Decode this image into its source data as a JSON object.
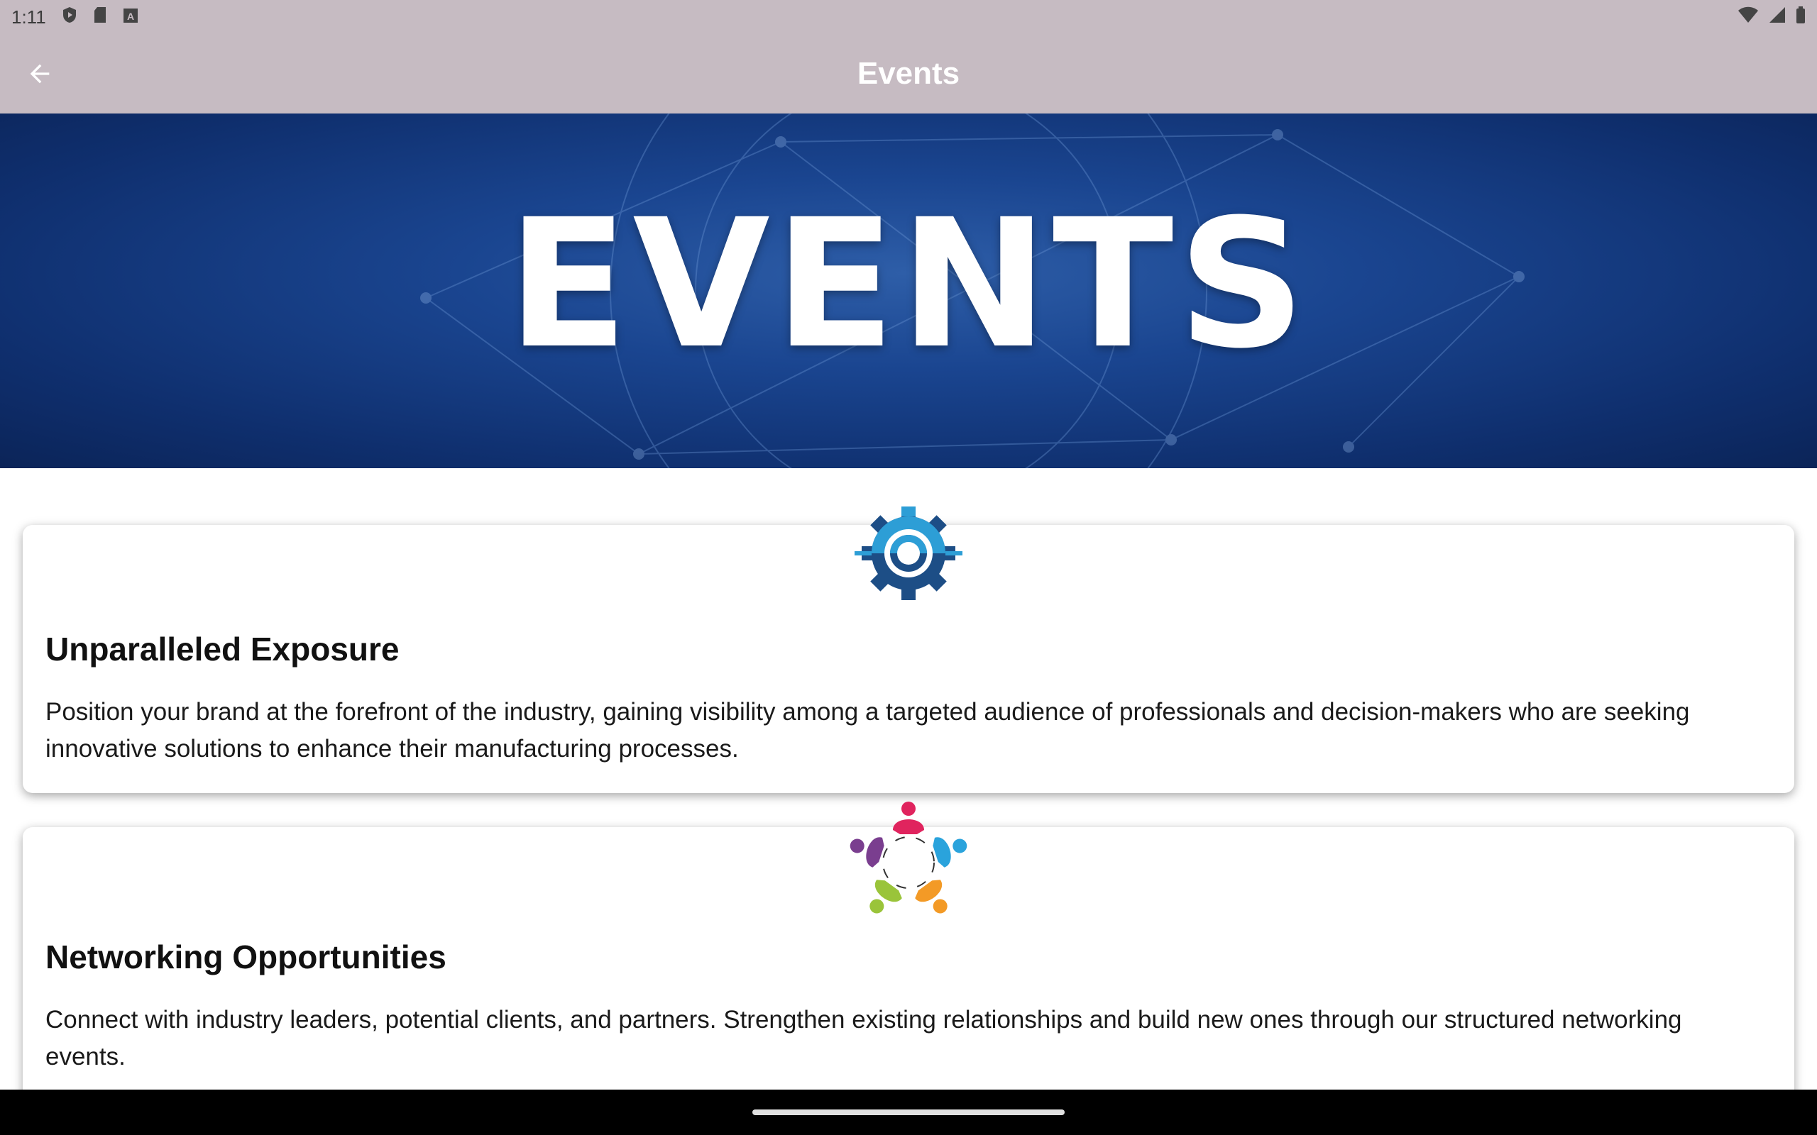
{
  "status_bar": {
    "time": "1:11"
  },
  "app_bar": {
    "title": "Events",
    "back_icon": "arrow-back-icon"
  },
  "banner": {
    "text": "EVENTS"
  },
  "cards": [
    {
      "icon": "gear-logo-icon",
      "title": "Unparalleled Exposure",
      "body": "Position your brand at the forefront of the industry, gaining visibility among a targeted audience of professionals and decision-makers who are seeking innovative solutions to enhance their manufacturing processes."
    },
    {
      "icon": "people-circle-icon",
      "title": "Networking Opportunities",
      "body": "Connect with industry leaders, potential clients, and partners. Strengthen existing relationships and build new ones through our structured networking events."
    }
  ],
  "colors": {
    "app_bar": "#c6bbc2",
    "banner_blue": "#1a4590"
  }
}
